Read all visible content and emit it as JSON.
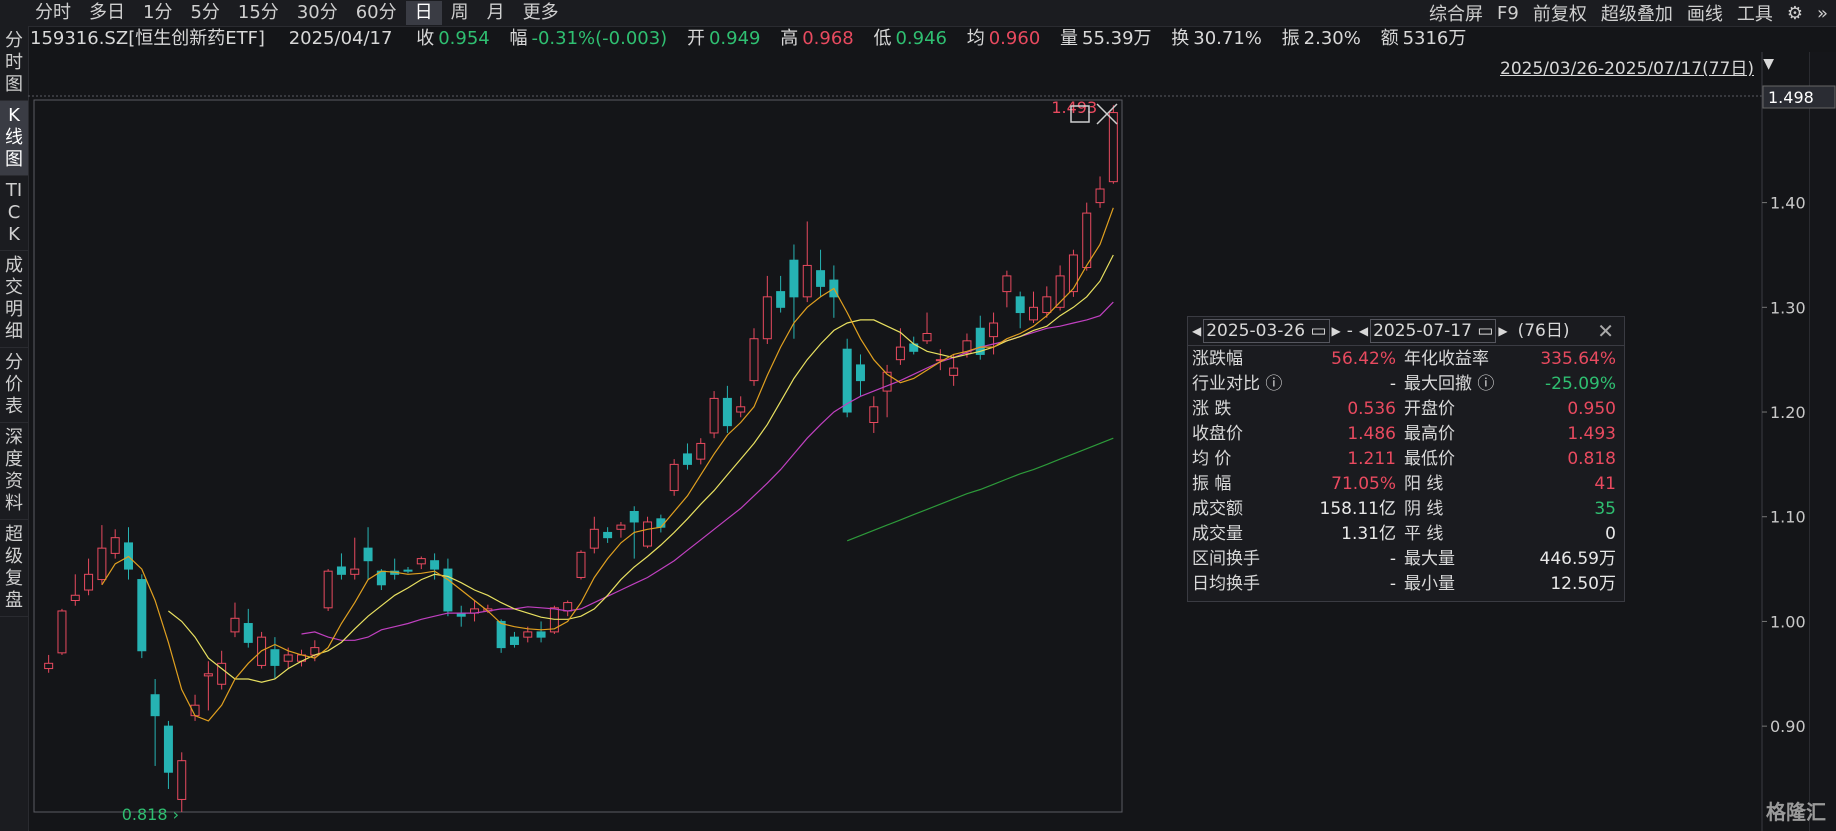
{
  "toolbar": {
    "periods": [
      "分时",
      "多日",
      "1分",
      "5分",
      "15分",
      "30分",
      "60分",
      "日",
      "周",
      "月",
      "更多"
    ],
    "active_period": "日",
    "right_items": [
      "综合屏",
      "F9",
      "前复权",
      "超级叠加",
      "画线",
      "工具"
    ]
  },
  "sidebar": {
    "items": [
      "分时图",
      "K线图",
      "TICK",
      "成交明细",
      "分价表",
      "深度资料",
      "超级复盘"
    ],
    "active": "K线图"
  },
  "quote": {
    "code": "159316.SZ[恒生创新药ETF]",
    "date": "2025/04/17",
    "close_label": "收",
    "close": "0.954",
    "change_label": "幅",
    "change": "-0.31%(-0.003)",
    "open_label": "开",
    "open": "0.949",
    "high_label": "高",
    "high": "0.968",
    "low_label": "低",
    "low": "0.946",
    "avg_label": "均",
    "avg": "0.960",
    "vol_label": "量",
    "vol": "55.39万",
    "turn_label": "换",
    "turn": "30.71%",
    "amp_label": "振",
    "amp": "2.30%",
    "amt_label": "额",
    "amt": "5316万"
  },
  "range_text": "2025/03/26-2025/07/17(77日)",
  "chart_data": {
    "type": "candlestick",
    "y_ticks": [
      "0.90",
      "1.00",
      "1.10",
      "1.20",
      "1.30",
      "1.40"
    ],
    "ylim": [
      0.818,
      1.498
    ],
    "y_marker": "1.498",
    "max_label": "1.493",
    "min_label": "0.818",
    "candles": [
      [
        0.955,
        0.96,
        0.951,
        0.968
      ],
      [
        0.97,
        1.01,
        0.968,
        1.012
      ],
      [
        1.02,
        1.025,
        1.015,
        1.045
      ],
      [
        1.03,
        1.045,
        1.025,
        1.06
      ],
      [
        1.04,
        1.07,
        1.035,
        1.092
      ],
      [
        1.065,
        1.08,
        1.06,
        1.088
      ],
      [
        1.075,
        1.05,
        1.04,
        1.09
      ],
      [
        1.04,
        0.972,
        0.965,
        1.045
      ],
      [
        0.93,
        0.91,
        0.862,
        0.945
      ],
      [
        0.9,
        0.856,
        0.84,
        0.905
      ],
      [
        0.83,
        0.867,
        0.818,
        0.875
      ],
      [
        0.91,
        0.92,
        0.905,
        0.93
      ],
      [
        0.948,
        0.95,
        0.915,
        0.962
      ],
      [
        0.94,
        0.96,
        0.935,
        0.972
      ],
      [
        0.99,
        1.003,
        0.985,
        1.018
      ],
      [
        0.998,
        0.98,
        0.975,
        1.012
      ],
      [
        0.958,
        0.985,
        0.955,
        0.99
      ],
      [
        0.973,
        0.958,
        0.945,
        0.985
      ],
      [
        0.962,
        0.968,
        0.955,
        0.975
      ],
      [
        0.962,
        0.968,
        0.957,
        0.973
      ],
      [
        0.968,
        0.975,
        0.962,
        0.982
      ],
      [
        1.013,
        1.048,
        1.01,
        1.05
      ],
      [
        1.052,
        1.045,
        1.04,
        1.065
      ],
      [
        1.045,
        1.05,
        1.04,
        1.08
      ],
      [
        1.07,
        1.058,
        1.04,
        1.09
      ],
      [
        1.048,
        1.035,
        1.03,
        1.05
      ],
      [
        1.048,
        1.045,
        1.04,
        1.06
      ],
      [
        1.049,
        1.048,
        1.046,
        1.052
      ],
      [
        1.055,
        1.06,
        1.05,
        1.062
      ],
      [
        1.058,
        1.05,
        1.04,
        1.065
      ],
      [
        1.05,
        1.01,
        1.005,
        1.06
      ],
      [
        1.008,
        1.005,
        0.995,
        1.015
      ],
      [
        1.008,
        1.012,
        1.0,
        1.02
      ],
      [
        1.01,
        1.012,
        1.008,
        1.016
      ],
      [
        1.0,
        0.975,
        0.97,
        1.002
      ],
      [
        0.985,
        0.978,
        0.975,
        0.99
      ],
      [
        0.985,
        0.99,
        0.98,
        0.995
      ],
      [
        0.99,
        0.985,
        0.98,
        1.0
      ],
      [
        0.99,
        1.013,
        0.988,
        1.015
      ],
      [
        1.01,
        1.018,
        1.005,
        1.02
      ],
      [
        1.042,
        1.066,
        1.04,
        1.068
      ],
      [
        1.07,
        1.088,
        1.065,
        1.1
      ],
      [
        1.085,
        1.08,
        1.075,
        1.09
      ],
      [
        1.088,
        1.092,
        1.08,
        1.095
      ],
      [
        1.105,
        1.095,
        1.06,
        1.11
      ],
      [
        1.072,
        1.095,
        1.07,
        1.1
      ],
      [
        1.098,
        1.09,
        1.085,
        1.102
      ],
      [
        1.125,
        1.15,
        1.12,
        1.155
      ],
      [
        1.16,
        1.15,
        1.145,
        1.17
      ],
      [
        1.155,
        1.17,
        1.15,
        1.175
      ],
      [
        1.18,
        1.213,
        1.175,
        1.22
      ],
      [
        1.213,
        1.187,
        1.18,
        1.225
      ],
      [
        1.2,
        1.205,
        1.195,
        1.215
      ],
      [
        1.23,
        1.27,
        1.225,
        1.28
      ],
      [
        1.27,
        1.31,
        1.265,
        1.33
      ],
      [
        1.315,
        1.3,
        1.295,
        1.33
      ],
      [
        1.345,
        1.31,
        1.27,
        1.36
      ],
      [
        1.31,
        1.34,
        1.305,
        1.382
      ],
      [
        1.335,
        1.32,
        1.31,
        1.355
      ],
      [
        1.326,
        1.31,
        1.29,
        1.34
      ],
      [
        1.26,
        1.2,
        1.195,
        1.27
      ],
      [
        1.245,
        1.23,
        1.215,
        1.255
      ],
      [
        1.19,
        1.205,
        1.18,
        1.215
      ],
      [
        1.22,
        1.238,
        1.195,
        1.245
      ],
      [
        1.25,
        1.262,
        1.245,
        1.28
      ],
      [
        1.265,
        1.258,
        1.255,
        1.272
      ],
      [
        1.268,
        1.275,
        1.265,
        1.295
      ],
      [
        1.25,
        1.25,
        1.24,
        1.26
      ],
      [
        1.235,
        1.242,
        1.225,
        1.255
      ],
      [
        1.256,
        1.268,
        1.252,
        1.275
      ],
      [
        1.28,
        1.255,
        1.25,
        1.292
      ],
      [
        1.272,
        1.285,
        1.255,
        1.295
      ],
      [
        1.315,
        1.33,
        1.3,
        1.335
      ],
      [
        1.31,
        1.295,
        1.28,
        1.315
      ],
      [
        1.288,
        1.3,
        1.285,
        1.315
      ],
      [
        1.295,
        1.31,
        1.29,
        1.32
      ],
      [
        1.3,
        1.33,
        1.297,
        1.34
      ],
      [
        1.315,
        1.35,
        1.31,
        1.355
      ],
      [
        1.338,
        1.39,
        1.335,
        1.4
      ],
      [
        1.4,
        1.413,
        1.395,
        1.425
      ],
      [
        1.42,
        1.486,
        1.418,
        1.493
      ]
    ],
    "ma5": [
      null,
      null,
      null,
      null,
      1.035,
      1.055,
      1.062,
      1.05,
      1.02,
      0.98,
      0.935,
      0.91,
      0.905,
      0.92,
      0.945,
      0.96,
      0.972,
      0.978,
      0.972,
      0.968,
      0.965,
      0.975,
      0.998,
      1.018,
      1.04,
      1.048,
      1.047,
      1.045,
      1.046,
      1.048,
      1.04,
      1.03,
      1.02,
      1.01,
      0.998,
      0.995,
      0.993,
      0.992,
      0.993,
      1.0,
      1.018,
      1.042,
      1.06,
      1.075,
      1.085,
      1.088,
      1.09,
      1.105,
      1.12,
      1.14,
      1.16,
      1.178,
      1.19,
      1.205,
      1.235,
      1.262,
      1.285,
      1.3,
      1.31,
      1.318,
      1.295,
      1.27,
      1.25,
      1.236,
      1.228,
      1.232,
      1.24,
      1.248,
      1.255,
      1.258,
      1.262,
      1.262,
      1.27,
      1.275,
      1.282,
      1.292,
      1.305,
      1.318,
      1.34,
      1.36,
      1.395
    ],
    "ma10": [
      null,
      null,
      null,
      null,
      null,
      null,
      null,
      null,
      null,
      1.01,
      1.0,
      0.985,
      0.965,
      0.955,
      0.945,
      0.945,
      0.942,
      0.945,
      0.955,
      0.962,
      0.968,
      0.972,
      0.98,
      0.993,
      1.005,
      1.015,
      1.025,
      1.032,
      1.04,
      1.045,
      1.043,
      1.037,
      1.03,
      1.025,
      1.018,
      1.012,
      1.008,
      1.004,
      1.002,
      1.002,
      1.005,
      1.012,
      1.025,
      1.04,
      1.052,
      1.062,
      1.073,
      1.085,
      1.098,
      1.112,
      1.125,
      1.14,
      1.155,
      1.17,
      1.188,
      1.21,
      1.232,
      1.25,
      1.265,
      1.278,
      1.285,
      1.288,
      1.288,
      1.282,
      1.276,
      1.265,
      1.258,
      1.255,
      1.252,
      1.255,
      1.258,
      1.262,
      1.268,
      1.272,
      1.278,
      1.282,
      1.292,
      1.3,
      1.31,
      1.325,
      1.35
    ],
    "ma20": [
      null,
      null,
      null,
      null,
      null,
      null,
      null,
      null,
      null,
      null,
      null,
      null,
      null,
      null,
      null,
      null,
      null,
      null,
      null,
      0.988,
      0.99,
      0.985,
      0.982,
      0.982,
      0.985,
      0.992,
      0.995,
      0.998,
      1.002,
      1.005,
      1.008,
      1.008,
      1.008,
      1.01,
      1.012,
      1.012,
      1.014,
      1.013,
      1.012,
      1.01,
      1.012,
      1.018,
      1.024,
      1.03,
      1.036,
      1.042,
      1.05,
      1.058,
      1.068,
      1.078,
      1.088,
      1.098,
      1.108,
      1.12,
      1.132,
      1.145,
      1.16,
      1.175,
      1.188,
      1.2,
      1.208,
      1.215,
      1.22,
      1.225,
      1.23,
      1.236,
      1.242,
      1.248,
      1.252,
      1.257,
      1.262,
      1.265,
      1.268,
      1.272,
      1.276,
      1.28,
      1.282,
      1.285,
      1.288,
      1.292,
      1.305
    ],
    "ma60": [
      null,
      null,
      null,
      null,
      null,
      null,
      null,
      null,
      null,
      null,
      null,
      null,
      null,
      null,
      null,
      null,
      null,
      null,
      null,
      null,
      null,
      null,
      null,
      null,
      null,
      null,
      null,
      null,
      null,
      null,
      null,
      null,
      null,
      null,
      null,
      null,
      null,
      null,
      null,
      null,
      null,
      null,
      null,
      null,
      null,
      null,
      null,
      null,
      null,
      null,
      null,
      null,
      null,
      null,
      null,
      null,
      null,
      null,
      null,
      null,
      1.077,
      1.082,
      1.087,
      1.092,
      1.097,
      1.102,
      1.107,
      1.112,
      1.117,
      1.122,
      1.126,
      1.131,
      1.136,
      1.141,
      1.145,
      1.15,
      1.155,
      1.16,
      1.165,
      1.17,
      1.175
    ],
    "colors": {
      "up": "#e84a5f",
      "down": "#26b3b3",
      "ma5": "#e0a020",
      "ma10": "#e8e060",
      "ma20": "#c040c0",
      "ma60": "#2d9a3a"
    }
  },
  "stats": {
    "start_date": "2025-03-26",
    "end_date": "2025-07-17",
    "days": "(76日)",
    "rows": [
      {
        "l1": "涨跌幅",
        "v1": "56.42%",
        "c1": "up",
        "l2": "年化收益率",
        "v2": "335.64%",
        "c2": "up"
      },
      {
        "l1": "行业对比 ⓘ",
        "v1": "-",
        "c1": "white",
        "l2": "最大回撤 ⓘ",
        "v2": "-25.09%",
        "c2": "down"
      },
      {
        "l1": "涨  跌",
        "v1": "0.536",
        "c1": "up",
        "l2": "开盘价",
        "v2": "0.950",
        "c2": "up"
      },
      {
        "l1": "收盘价",
        "v1": "1.486",
        "c1": "up",
        "l2": "最高价",
        "v2": "1.493",
        "c2": "up"
      },
      {
        "l1": "均  价",
        "v1": "1.211",
        "c1": "up",
        "l2": "最低价",
        "v2": "0.818",
        "c2": "up"
      },
      {
        "l1": "振  幅",
        "v1": "71.05%",
        "c1": "up",
        "l2": "阳  线",
        "v2": "41",
        "c2": "up"
      },
      {
        "l1": "成交额",
        "v1": "158.11亿",
        "c1": "white",
        "l2": "阴  线",
        "v2": "35",
        "c2": "down"
      },
      {
        "l1": "成交量",
        "v1": "1.31亿",
        "c1": "white",
        "l2": "平  线",
        "v2": "0",
        "c2": "white"
      },
      {
        "l1": "区间换手",
        "v1": "-",
        "c1": "white",
        "l2": "最大量",
        "v2": "446.59万",
        "c2": "white"
      },
      {
        "l1": "日均换手",
        "v1": "-",
        "c1": "white",
        "l2": "最小量",
        "v2": "12.50万",
        "c2": "white"
      }
    ]
  },
  "watermark": "格隆汇"
}
